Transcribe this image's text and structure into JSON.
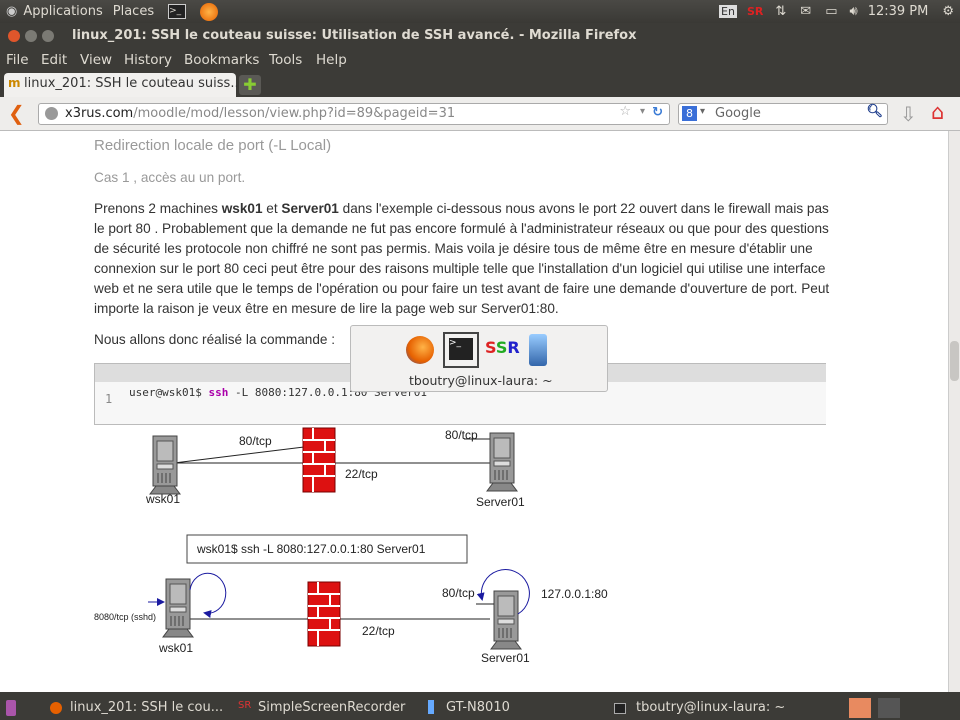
{
  "top_panel": {
    "applications": "Applications",
    "places": "Places",
    "keyboard": "En",
    "clock": "12:39 PM"
  },
  "window": {
    "title": "linux_201: SSH le couteau suisse: Utilisation de SSH avancé. - Mozilla Firefox"
  },
  "menu": [
    "File",
    "Edit",
    "View",
    "History",
    "Bookmarks",
    "Tools",
    "Help"
  ],
  "tab": {
    "label": "linux_201: SSH le couteau suiss..."
  },
  "nav": {
    "url_domain": "x3rus.com",
    "url_path": "/moodle/mod/lesson/view.php?id=89&pageid=31",
    "search_placeholder": "Google"
  },
  "page": {
    "heading": "Redirection locale de port (-L Local)",
    "subheading": "Cas 1 , accès au un port.",
    "para_pre": "Prenons 2 machines ",
    "wsk01": "wsk01",
    "para_and": " et ",
    "server01": "Server01",
    "para_post": " dans l'exemple ci-dessous nous avons le port 22 ouvert dans le firewall mais pas le port 80 . Probablement que la demande ne fut pas encore formulé à l'administrateur réseaux ou que pour des questions de sécurité les protocole non chiffré ne sont pas permis. Mais voila je désire tous de même être en mesure d'établir une connexion sur le port 80 ceci peut être pour des raisons multiple telle que l'installation d'un logiciel qui utilise une interface web et ne sera utile que le temps de l'opération ou pour faire un test avant de faire une demande d'ouverture de port. Peut importe la raison je veux être en mesure de lire la page web sur Server01:80.",
    "command_intro": "Nous allons donc réalisé la commande :",
    "code": {
      "line_no": "1",
      "prompt": "user@wsk01$ ",
      "cmd": "ssh",
      "args": " -L 8080:127.0.0.1:80 Server01"
    }
  },
  "diagram": {
    "top": {
      "client": "wsk01",
      "server": "Server01",
      "blocked": "80/tcp",
      "open": "22/tcp",
      "server_port": "80/tcp"
    },
    "command": "wsk01$ ssh -L 8080:127.0.0.1:80 Server01",
    "bottom": {
      "client": "wsk01",
      "server": "Server01",
      "local": "8080/tcp (sshd)",
      "open": "22/tcp",
      "server_port": "80/tcp",
      "loop": "127.0.0.1:80"
    }
  },
  "switcher": {
    "label": "tboutry@linux-laura: ~"
  },
  "taskbar": [
    "linux_201: SSH le cou...",
    "SimpleScreenRecorder",
    "GT-N8010",
    "tboutry@linux-laura: ~"
  ]
}
